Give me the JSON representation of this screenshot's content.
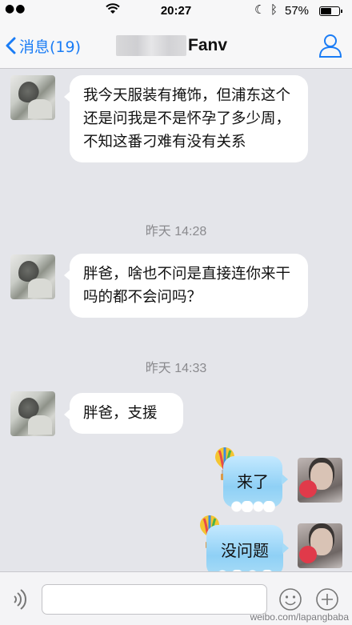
{
  "status_bar": {
    "time": "20:27",
    "battery_percent": "57%",
    "battery_level": 0.57,
    "icons": [
      "signal-icon",
      "wifi-icon",
      "moon-icon",
      "bluetooth-icon",
      "battery-icon"
    ]
  },
  "nav": {
    "back_label": "消息(19)",
    "title": "Fanv",
    "accent_color": "#1a7cf5"
  },
  "messages": [
    {
      "side": "left",
      "text": "我今天服装有掩饰，但浦东这个还是问我是不是怀孕了多少周，不知这番刁难有没有关系"
    },
    {
      "type": "timestamp",
      "text": "昨天 14:28"
    },
    {
      "side": "left",
      "text": "胖爸，啥也不问是直接连你来干吗的都不会问吗？"
    },
    {
      "type": "timestamp",
      "text": "昨天 14:33"
    },
    {
      "side": "left",
      "text": "胖爸，支援"
    },
    {
      "side": "right",
      "text": "来了"
    },
    {
      "side": "right",
      "text": "没问题"
    }
  ],
  "input": {
    "placeholder": ""
  },
  "watermark": "weibo.com/lapangbaba"
}
